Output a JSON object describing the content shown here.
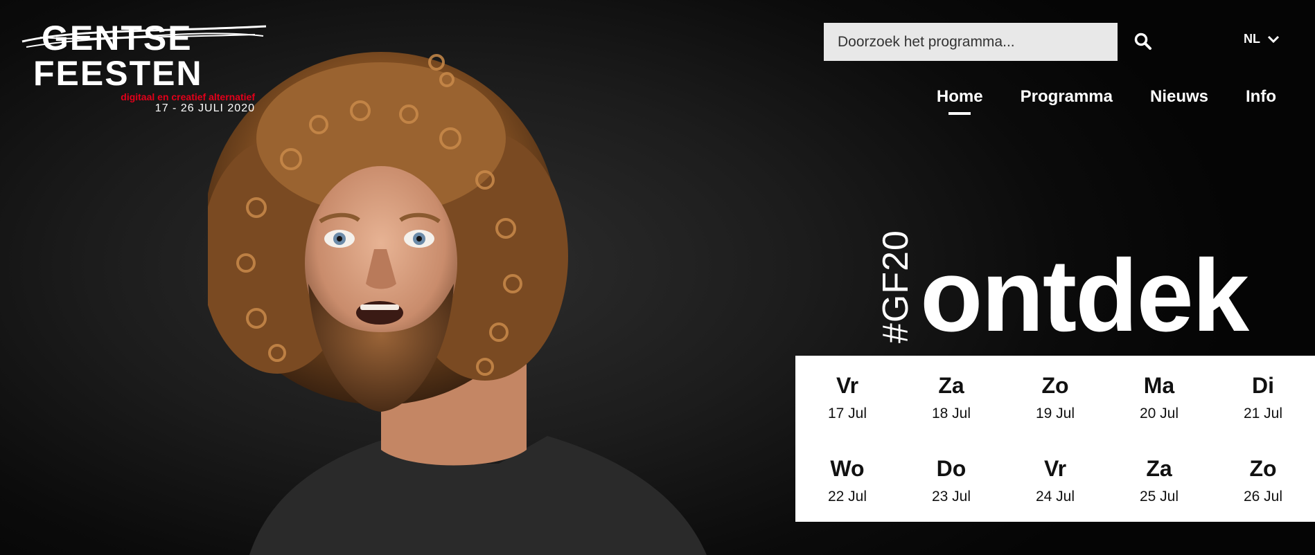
{
  "logo": {
    "line1": "GENTSE",
    "line2": "FEESTEN",
    "tagline": "digitaal en creatief alternatief",
    "dates": "17 - 26 JULI 2020"
  },
  "search": {
    "placeholder": "Doorzoek het programma...",
    "icon": "search-icon"
  },
  "language": {
    "selected": "NL",
    "icon": "chevron-down-icon"
  },
  "nav": {
    "items": [
      {
        "label": "Home",
        "active": true
      },
      {
        "label": "Programma",
        "active": false
      },
      {
        "label": "Nieuws",
        "active": false
      },
      {
        "label": "Info",
        "active": false
      }
    ]
  },
  "headline": {
    "hashtag": "#GF20",
    "word": "ontdek"
  },
  "calendar": {
    "days": [
      {
        "day": "Vr",
        "date": "17 Jul"
      },
      {
        "day": "Za",
        "date": "18 Jul"
      },
      {
        "day": "Zo",
        "date": "19 Jul"
      },
      {
        "day": "Ma",
        "date": "20 Jul"
      },
      {
        "day": "Di",
        "date": "21 Jul"
      },
      {
        "day": "Wo",
        "date": "22 Jul"
      },
      {
        "day": "Do",
        "date": "23 Jul"
      },
      {
        "day": "Vr",
        "date": "24 Jul"
      },
      {
        "day": "Za",
        "date": "25 Jul"
      },
      {
        "day": "Zo",
        "date": "26 Jul"
      }
    ]
  },
  "colors": {
    "background": "#000000",
    "accent_red": "#e2001a",
    "text": "#ffffff",
    "search_bg": "#e8e8e8"
  }
}
